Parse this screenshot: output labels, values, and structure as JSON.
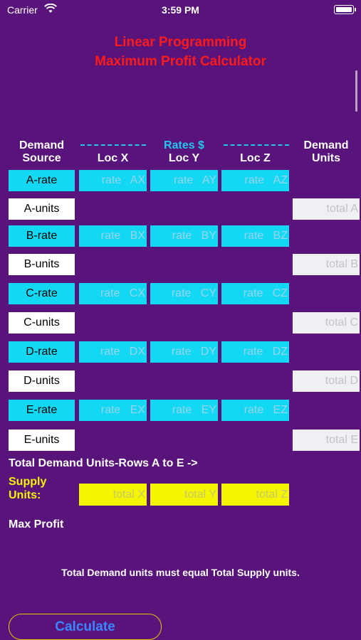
{
  "status": {
    "carrier": "Carrier",
    "time": "3:59 PM"
  },
  "title": {
    "line1": "Linear Programming",
    "line2": "Maximum Profit Calculator"
  },
  "headers": {
    "demand_source": [
      "Demand",
      "Source"
    ],
    "rates": "Rates $",
    "loc_x": "Loc X",
    "loc_y": "Loc Y",
    "loc_z": "Loc Z",
    "demand_units": [
      "Demand",
      "Units"
    ]
  },
  "rows": [
    {
      "rate_label": "A-rate",
      "units_label": "A-units",
      "placeholders": [
        "rate   AX",
        "rate   AY",
        "rate   AZ"
      ],
      "total_placeholder": "total A"
    },
    {
      "rate_label": "B-rate",
      "units_label": "B-units",
      "placeholders": [
        "rate   BX",
        "rate   BY",
        "rate   BZ"
      ],
      "total_placeholder": "total B"
    },
    {
      "rate_label": "C-rate",
      "units_label": "C-units",
      "placeholders": [
        "rate   CX",
        "rate   CY",
        "rate   CZ"
      ],
      "total_placeholder": "total C"
    },
    {
      "rate_label": "D-rate",
      "units_label": "D-units",
      "placeholders": [
        "rate   DX",
        "rate   DY",
        "rate   DZ"
      ],
      "total_placeholder": "total D"
    },
    {
      "rate_label": "E-rate",
      "units_label": "E-units",
      "placeholders": [
        "rate   EX",
        "rate   EY",
        "rate   EZ"
      ],
      "total_placeholder": "total E"
    }
  ],
  "total_demand_label": "Total Demand Units-Rows A to E ->",
  "supply": {
    "label_line1": "Supply",
    "label_line2": "Units:",
    "placeholders": [
      "total X",
      "total Y",
      "total Z"
    ]
  },
  "max_profit_label": "Max Profit",
  "note": "Total Demand units must equal Total Supply units.",
  "calculate_label": "Calculate",
  "colors": {
    "background": "#58147a",
    "title": "#ff1a1a",
    "rate": "#12d8f4",
    "supply": "#f5f500",
    "button_text": "#3a86ff"
  }
}
